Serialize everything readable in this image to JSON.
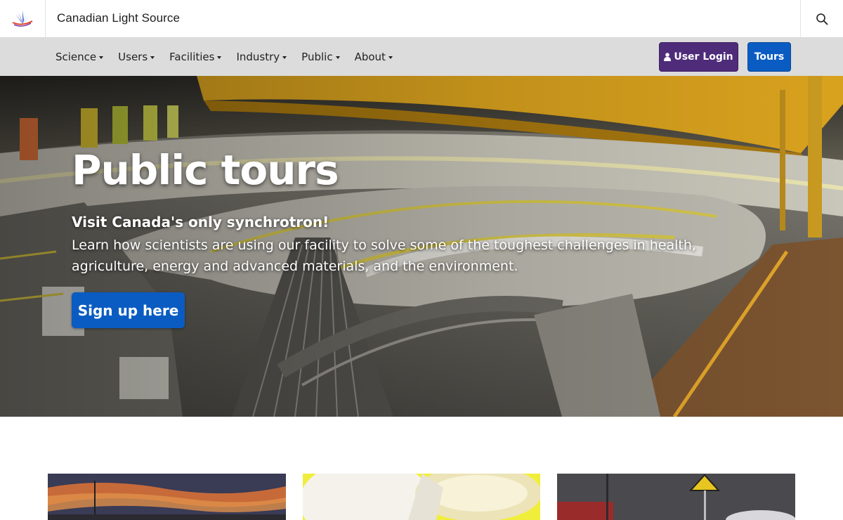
{
  "header": {
    "site_title": "Canadian Light Source",
    "logo_icon": "cls-logo-icon",
    "search_icon": "search-icon"
  },
  "nav": {
    "items": [
      {
        "label": "Science"
      },
      {
        "label": "Users"
      },
      {
        "label": "Facilities"
      },
      {
        "label": "Industry"
      },
      {
        "label": "Public"
      },
      {
        "label": "About"
      }
    ],
    "login_label": "User Login",
    "tours_label": "Tours"
  },
  "hero": {
    "title": "Public tours",
    "subtitle": "Visit Canada's only synchrotron!",
    "description": "Learn how scientists are using our facility to solve some of the toughest challenges in health, agriculture, energy and advanced materials, and the environment.",
    "cta_label": "Sign up here"
  },
  "colors": {
    "login_button": "#4f2c7a",
    "primary_button": "#0a5cc2",
    "navbar_bg": "#dcdcdc"
  }
}
